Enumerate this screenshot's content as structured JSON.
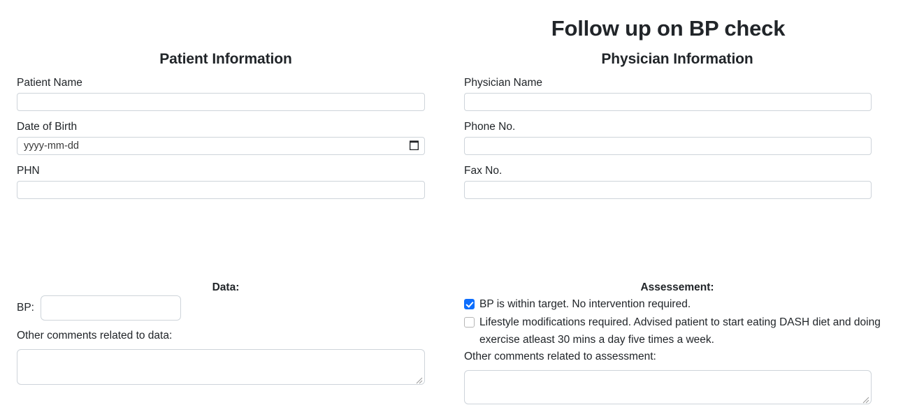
{
  "page": {
    "title": "Follow up on BP check"
  },
  "patient": {
    "heading": "Patient Information",
    "name_label": "Patient Name",
    "name_value": "",
    "dob_label": "Date of Birth",
    "dob_placeholder": "yyyy-mm-dd",
    "dob_value": "",
    "phn_label": "PHN",
    "phn_value": ""
  },
  "physician": {
    "heading": "Physician Information",
    "name_label": "Physician Name",
    "name_value": "",
    "phone_label": "Phone No.",
    "phone_value": "",
    "fax_label": "Fax No.",
    "fax_value": ""
  },
  "data_section": {
    "heading": "Data:",
    "bp_label": "BP:",
    "bp_value": "",
    "comments_label": "Other comments related to data:",
    "comments_value": ""
  },
  "assessment_section": {
    "heading": "Assessement:",
    "options": [
      {
        "label": "BP is within target. No intervention required.",
        "checked": true
      },
      {
        "label": "Lifestyle modifications required. Advised patient to start eating DASH diet and doing exercise atleast 30 mins a day five times a week.",
        "checked": false
      }
    ],
    "comments_label": "Other comments related to assessment:",
    "comments_value": ""
  },
  "icons": {
    "calendar": "calendar-icon",
    "resize": "resize-grip-icon"
  },
  "colors": {
    "accent": "#0d6efd",
    "border": "#ced4da",
    "text": "#212529",
    "placeholder": "#757575"
  }
}
